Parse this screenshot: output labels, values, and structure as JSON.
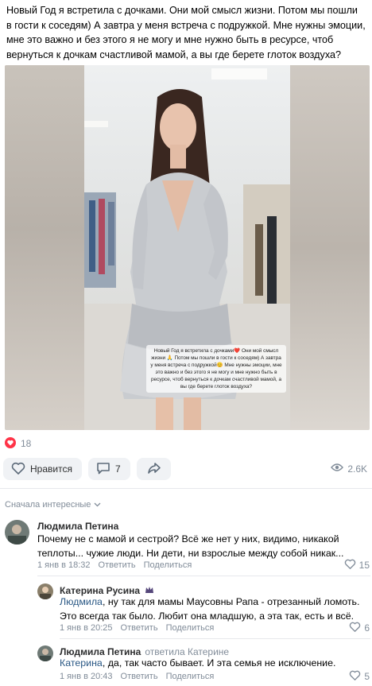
{
  "post": {
    "text": "Новый Год я встретила с дочками. Они мой смысл жизни. Потом мы пошли в гости к соседям) А завтра у меня встреча с подружкой. Мне нужны эмоции, мне это важно и без этого я не могу и мне нужно быть в ресурсе, чтоб вернуться к дочкам счастливой мамой, а вы где берете глоток воздуха?",
    "image_caption": "Новый Год я встретила с дочками❤️ Они мой смысл жизни 🙏 Потом мы пошли в гости к соседям) А завтра у меня встреча с подружкой😊 Мне нужны эмоции, мне это важно и без этого я не могу и мне нужно быть в ресурсе, чтоб вернуться к дочкам счастливой мамой, а вы где берете глоток воздуха?",
    "likes_count": "18",
    "like_label": "Нравится",
    "comments_count": "7",
    "views": "2.6K"
  },
  "comments_header": {
    "sort_label": "Сначала интересные"
  },
  "comments": [
    {
      "author": "Людмила Петина",
      "text": "Почему не с мамой и сестрой? Всё же нет у них, видимо, никакой теплоты... чужие люди. Ни дети, ни взрослые между собой никак...",
      "date": "1 янв в 18:32",
      "reply_label": "Ответить",
      "share_label": "Поделиться",
      "likes": "15"
    },
    {
      "author": "Катерина Русина",
      "reply_to": "Людмила",
      "text": ", ну так для мамы Маусовны Рапа - отрезанный ломоть. Это всегда так было. Любит она младшую, а эта так, есть и всё.",
      "date": "1 янв в 20:25",
      "reply_label": "Ответить",
      "share_label": "Поделиться",
      "likes": "6"
    },
    {
      "author": "Людмила Петина",
      "answered": "ответила Катерине",
      "reply_to": "Катерина",
      "text": ", да, так часто бывает. И эта семья не исключение.",
      "date": "1 янв в 20:43",
      "reply_label": "Ответить",
      "share_label": "Поделиться",
      "likes": "5"
    }
  ]
}
